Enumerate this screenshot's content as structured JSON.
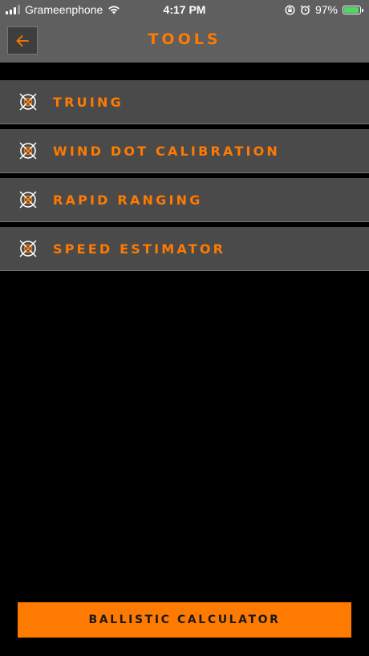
{
  "status_bar": {
    "carrier": "Grameenphone",
    "time": "4:17 PM",
    "battery_percent": "97%",
    "battery_level": 0.97
  },
  "header": {
    "title": "TOOLS",
    "back_icon": "arrow-left-icon"
  },
  "tools": [
    {
      "label": "TRUING",
      "icon": "target-icon"
    },
    {
      "label": "WIND DOT CALIBRATION",
      "icon": "target-icon"
    },
    {
      "label": "RAPID RANGING",
      "icon": "target-icon"
    },
    {
      "label": "SPEED ESTIMATOR",
      "icon": "target-icon"
    }
  ],
  "footer": {
    "button_label": "BALLISTIC CALCULATOR"
  },
  "colors": {
    "accent": "#ff7a00",
    "header_bg": "#5f5f5f",
    "item_bg": "#4a4a4a",
    "background": "#000000"
  }
}
